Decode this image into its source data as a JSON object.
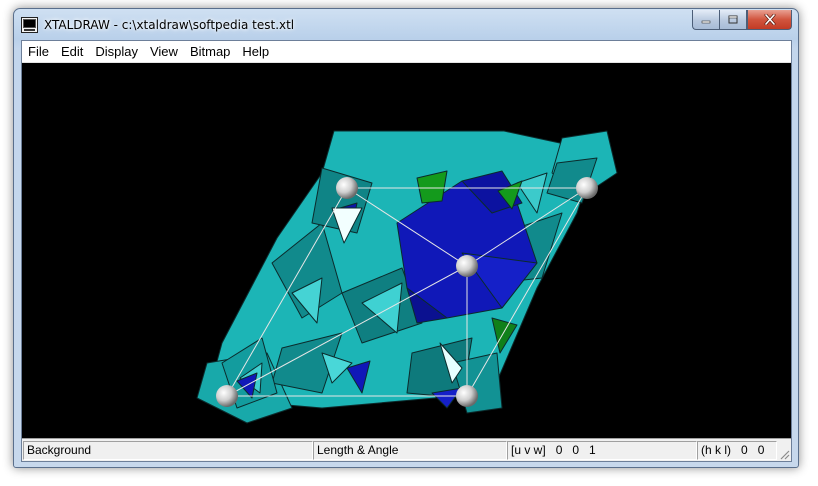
{
  "window": {
    "title": "XTALDRAW - c:\\xtaldraw\\softpedia test.xtl",
    "icon": "app-icon",
    "caption_icons": [
      "minimize-icon",
      "maximize-icon",
      "close-icon"
    ]
  },
  "menu": [
    {
      "label": "File"
    },
    {
      "label": "Edit"
    },
    {
      "label": "Display"
    },
    {
      "label": "View"
    },
    {
      "label": "Bitmap"
    },
    {
      "label": "Help"
    }
  ],
  "viewport": {
    "background": "#000000",
    "colors": {
      "cyan": "#1cb5b6",
      "teal": "#118a8c",
      "blue": "#1018b8",
      "green": "#149a1c",
      "atom": "#c9c9c9",
      "cell_edge": "#e6e6e6"
    }
  },
  "status": {
    "background": "Background",
    "length_angle": "Length & Angle",
    "uvw_label": "[u v w]",
    "uvw_values": "0   0   1",
    "hkl_label": "(h k l)",
    "hkl_values": "0   0"
  }
}
